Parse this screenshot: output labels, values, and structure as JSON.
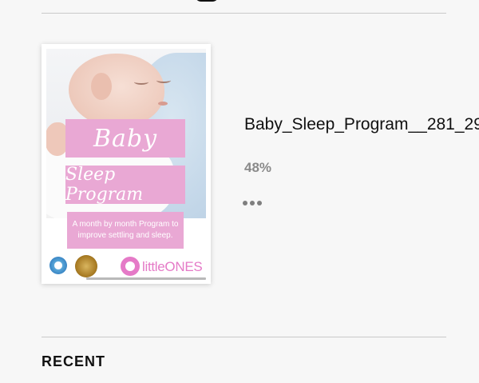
{
  "book": {
    "title": "Baby_Sleep_Program__281_29",
    "progress": "48%",
    "cover": {
      "line1": "Baby",
      "line2": "Sleep Program",
      "description": "A month by month Program to improve settling and sleep.",
      "brand_logo_text": "littleONES"
    },
    "more_icon": "ellipsis-icon"
  },
  "sections": {
    "recent_heading": "RECENT"
  },
  "colors": {
    "background": "#f7f7f7",
    "cover_pink": "#e9a8d4",
    "brand_pink": "#e57ac7",
    "progress_gray": "#8a8a8a"
  }
}
